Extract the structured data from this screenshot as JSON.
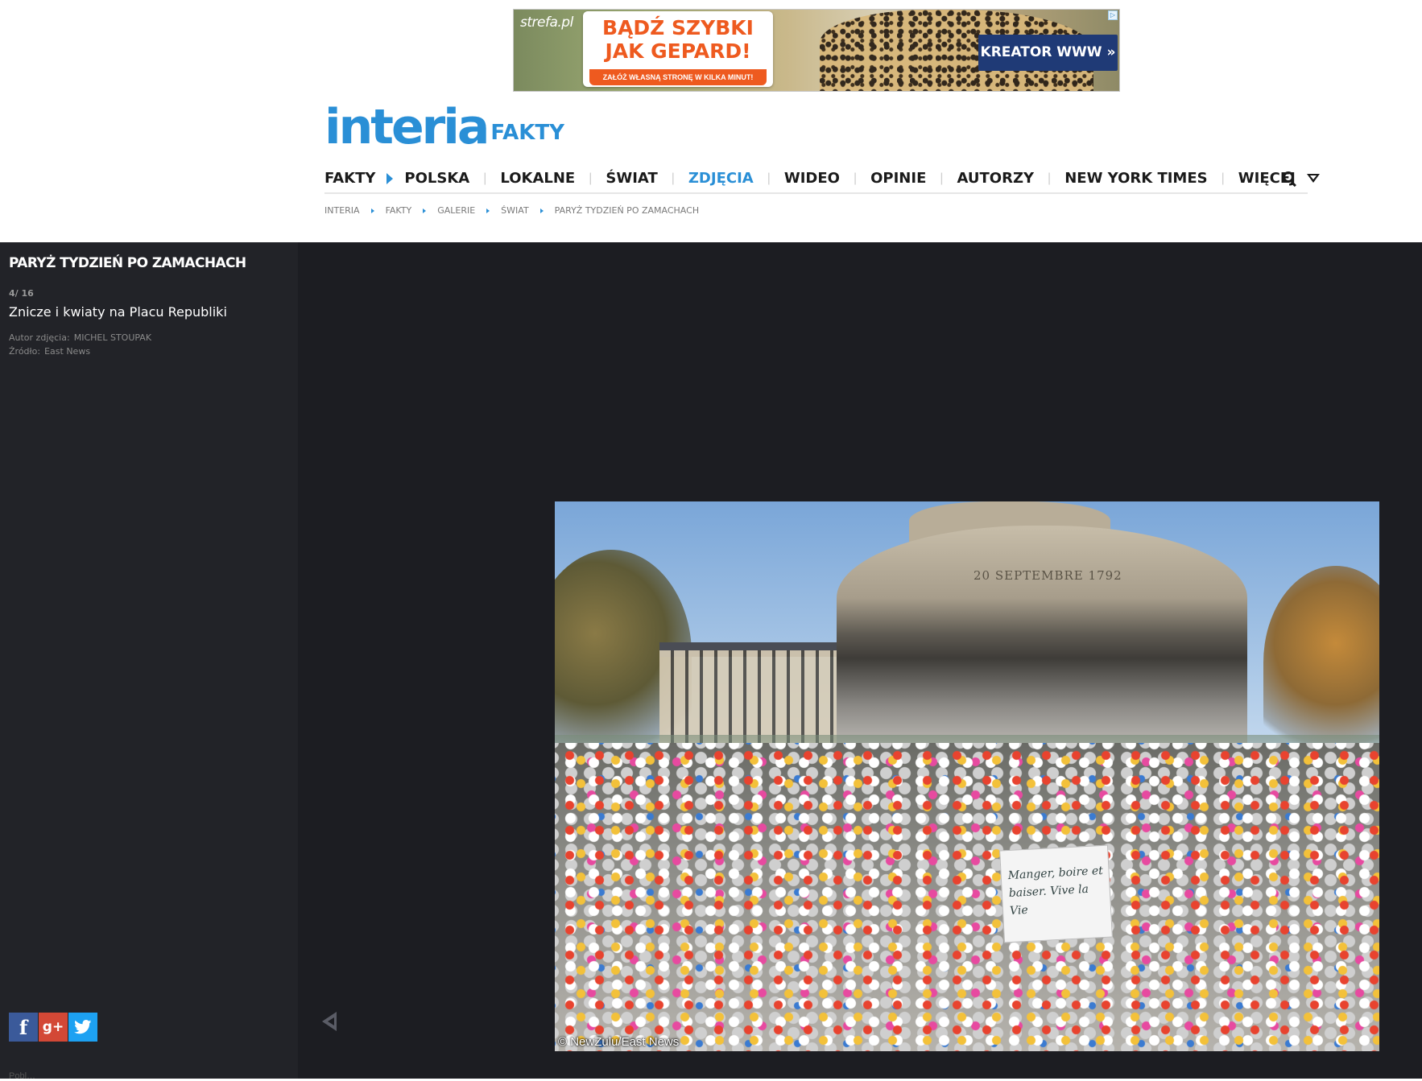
{
  "ad": {
    "brand": "strefa.pl",
    "headline_1": "BĄDŹ SZYBKI",
    "headline_2": "JAK GEPARD!",
    "sub": "ZAŁÓŻ WŁASNĄ STRONĘ W KILKA MINUT!",
    "cta": "KREATOR WWW »",
    "adchoice": "▷"
  },
  "logo": {
    "main": "interia",
    "sub": "FAKTY"
  },
  "nav": {
    "items": [
      {
        "label": "FAKTY"
      },
      {
        "label": "POLSKA"
      },
      {
        "label": "LOKALNE"
      },
      {
        "label": "ŚWIAT"
      },
      {
        "label": "ZDJĘCIA"
      },
      {
        "label": "WIDEO"
      },
      {
        "label": "OPINIE"
      },
      {
        "label": "AUTORZY"
      },
      {
        "label": "NEW YORK TIMES"
      },
      {
        "label": "WIĘCEJ"
      }
    ],
    "separator": "|",
    "active": "ZDJĘCIA",
    "accent_color": "#2a8fd6"
  },
  "breadcrumb": [
    "INTERIA",
    "FAKTY",
    "GALERIE",
    "ŚWIAT",
    "PARYŻ TYDZIEŃ PO ZAMACHACH"
  ],
  "gallery": {
    "title": "PARYŻ TYDZIEŃ PO ZAMACHACH",
    "counter": "4/ 16",
    "caption": "Znicze i kwiaty na Placu Republiki",
    "author_label": "Autor zdjęcia:",
    "author": "MICHEL STOUPAK",
    "source_label": "Źródło:",
    "source": "East News",
    "photo_copyright": "© NewZulu/East News",
    "photo_inscription": "20 SEPTEMBRE 1792",
    "photo_sign": "Manger, boire et baiser. Vive la Vie",
    "below_text": "Pobl…"
  },
  "share": [
    {
      "network": "facebook",
      "icon": "f"
    },
    {
      "network": "google-plus",
      "icon": "g+"
    },
    {
      "network": "twitter",
      "icon": "twitter-bird-icon"
    }
  ],
  "colors": {
    "gallery_bg": "#1c1d22",
    "sidebar_bg": "#222328",
    "facebook": "#3b5a9a",
    "google_plus": "#d34836",
    "twitter": "#1da1f2"
  }
}
